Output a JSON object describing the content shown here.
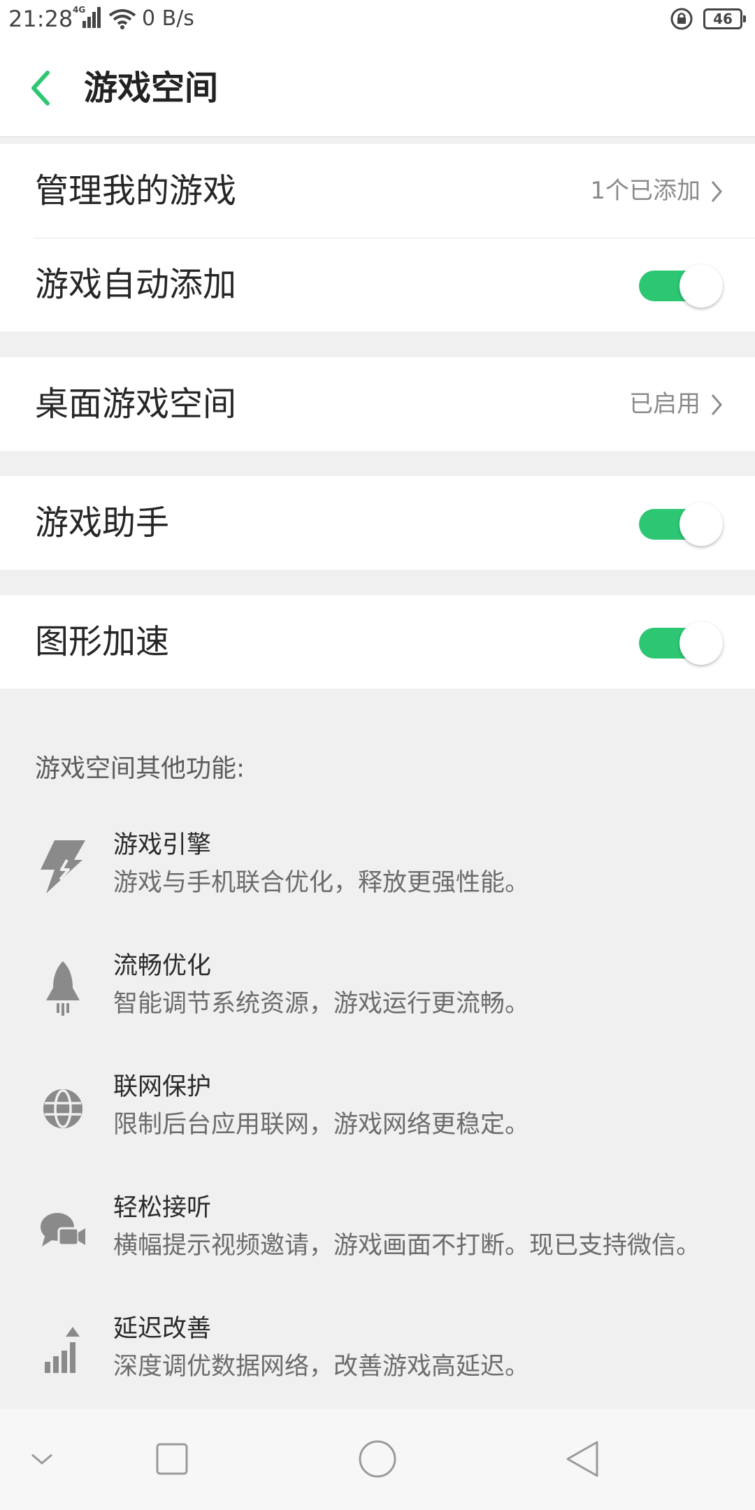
{
  "status_bar": {
    "time": "21:28",
    "network": "4G",
    "speed": "0 B/s",
    "battery": "46"
  },
  "header": {
    "title": "游戏空间",
    "accent_color": "#2dc774"
  },
  "settings": {
    "manage_games": {
      "label": "管理我的游戏",
      "value": "1个已添加"
    },
    "auto_add": {
      "label": "游戏自动添加",
      "enabled": true
    },
    "desktop_space": {
      "label": "桌面游戏空间",
      "value": "已启用"
    },
    "assistant": {
      "label": "游戏助手",
      "enabled": true
    },
    "graphics_acceleration": {
      "label": "图形加速",
      "enabled": true
    }
  },
  "other_features": {
    "heading": "游戏空间其他功能:",
    "items": [
      {
        "icon": "lightning-icon",
        "title": "游戏引擎",
        "description": "游戏与手机联合优化，释放更强性能。"
      },
      {
        "icon": "rocket-icon",
        "title": "流畅优化",
        "description": "智能调节系统资源，游戏运行更流畅。"
      },
      {
        "icon": "globe-icon",
        "title": "联网保护",
        "description": "限制后台应用联网，游戏网络更稳定。"
      },
      {
        "icon": "video-chat-icon",
        "title": "轻松接听",
        "description": "横幅提示视频邀请，游戏画面不打断。现已支持微信。"
      },
      {
        "icon": "signal-bars-icon",
        "title": "延迟改善",
        "description": "深度调优数据网络，改善游戏高延迟。"
      }
    ]
  },
  "nav_bar": {
    "buttons": [
      "chevron-down-icon",
      "recents-square-icon",
      "home-circle-icon",
      "back-triangle-icon"
    ]
  }
}
